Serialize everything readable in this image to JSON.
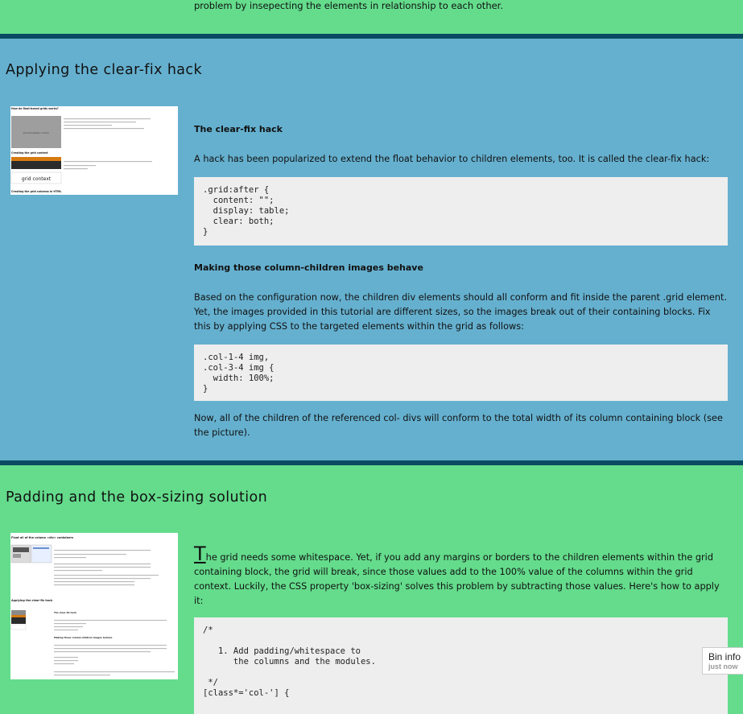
{
  "top": {
    "tail_text": "problem by insepecting the elements in relationship to each other."
  },
  "section1": {
    "title": "Applying the clear-fix hack",
    "thumb": {
      "heading1": "How do float-based grids works?",
      "placeholder": "grid-template-column",
      "heading2": "Creating the grid context",
      "context_label": "grid context",
      "heading3": "Creating the grid columns in HTML"
    },
    "clearfix_heading": "The clear-fix hack",
    "clearfix_text": "A hack has been popularized to extend the float behavior to children elements, too. It is called the clear-fix hack:",
    "code1": ".grid:after {\n  content: \"\";\n  display: table;\n  clear: both;\n}",
    "images_heading": "Making those column-children images behave",
    "images_text": "Based on the configuration now, the children div elements should all conform and fit inside the parent .grid element. Yet, the images provided in this tutorial are different sizes, so the images break out of their containing blocks. Fix this by applying CSS to the targeted elements within the grid as follows:",
    "code2": ".col-1-4 img,\n.col-3-4 img {\n  width: 100%;\n}",
    "closing_text": "Now, all of the children of the referenced col- divs will conform to the total width of its column containing block (see the picture)."
  },
  "section2": {
    "title": "Padding and the box-sizing solution",
    "thumb": {
      "heading1": "Float all of the column <div> containers",
      "heading2": "Applying the clear-fix hack",
      "subheading": "The clear-fix hack",
      "subheading2": "Making those column-children images behave"
    },
    "dropcap": "T",
    "intro_text": "he grid needs some whitespace. Yet, if you add any margins or borders to the children elements within the grid containing block, the grid will break, since those values add to the 100% value of the columns within the grid context. Luckily, the CSS property 'box-sizing' solves this problem by subtracting those values. Here's how to apply it:",
    "code3": "/*\n\n   1. Add padding/whitespace to\n      the columns and the modules.\n\n */\n[class*='col-'] {"
  },
  "bin_info": {
    "title": "Bin info",
    "subtitle": "just now"
  },
  "colors": {
    "green": "#64dc8c",
    "blue": "#65b0cf",
    "divider": "#0a4a63",
    "code_bg": "#eeeeee"
  }
}
